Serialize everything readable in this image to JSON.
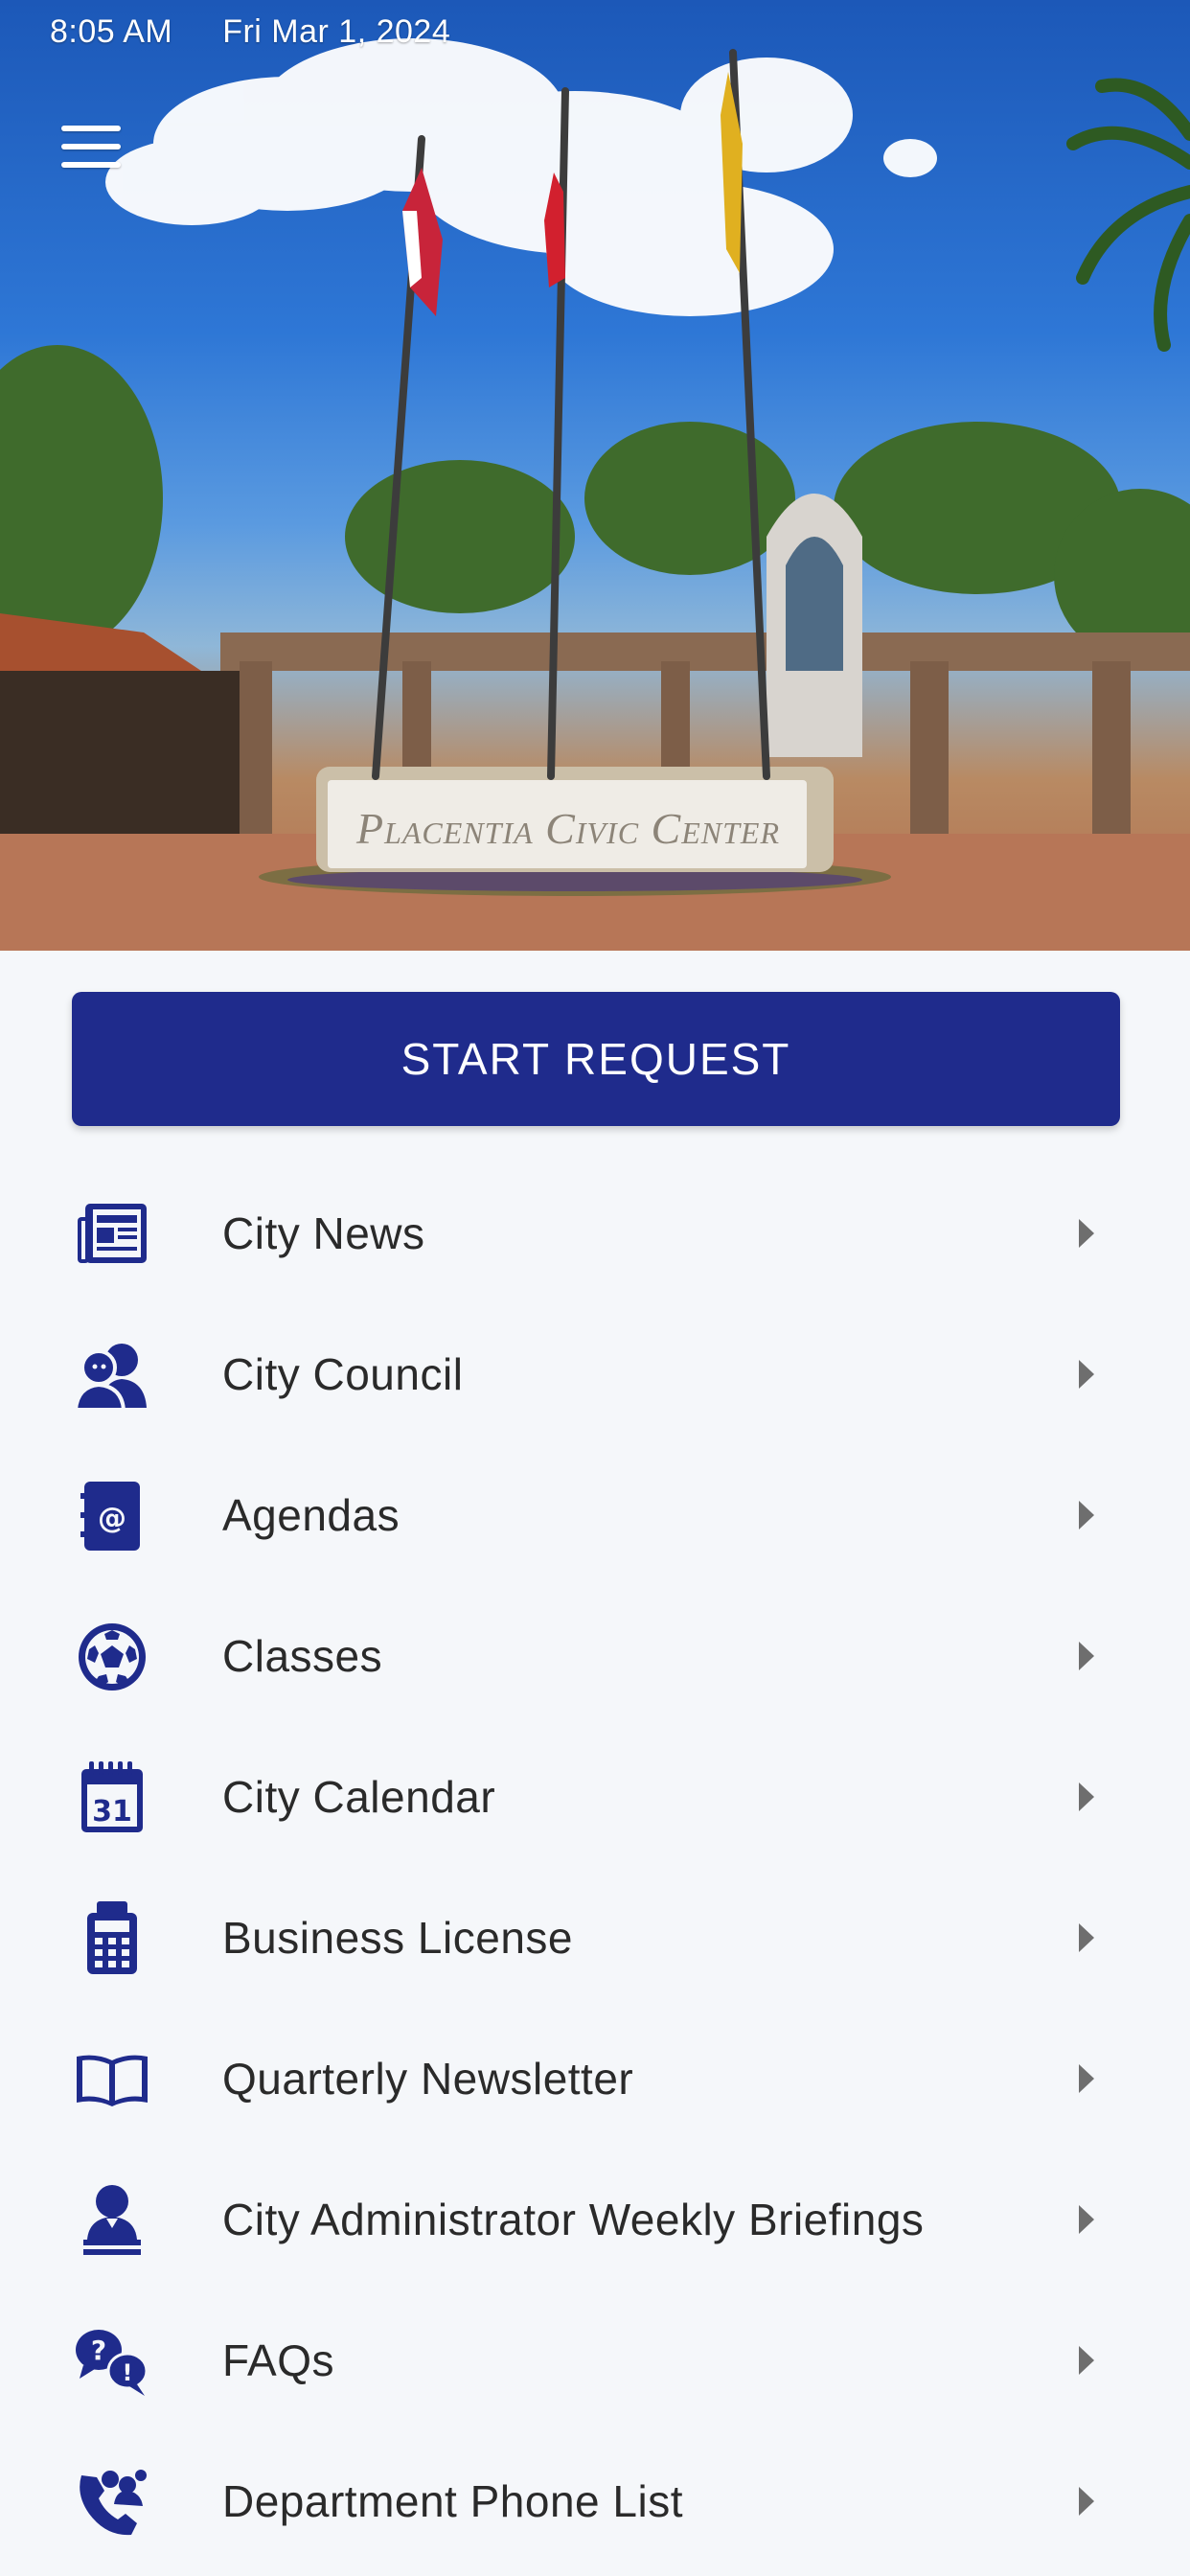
{
  "status_bar": {
    "time": "8:05 AM",
    "date": "Fri Mar 1, 2024"
  },
  "hero": {
    "sign_text": "Placentia Civic Center"
  },
  "start_request": {
    "label": "START REQUEST"
  },
  "colors": {
    "brand": "#1f2b8c",
    "background": "#f5f7fa",
    "text": "#2a2a2a"
  },
  "menu": {
    "items": [
      {
        "label": "City News",
        "icon": "newspaper-icon"
      },
      {
        "label": "City Council",
        "icon": "people-icon"
      },
      {
        "label": "Agendas",
        "icon": "address-book-icon"
      },
      {
        "label": "Classes",
        "icon": "soccer-ball-icon"
      },
      {
        "label": "City Calendar",
        "icon": "calendar-icon"
      },
      {
        "label": "Business License",
        "icon": "calculator-icon"
      },
      {
        "label": "Quarterly Newsletter",
        "icon": "open-book-icon"
      },
      {
        "label": "City Administrator Weekly Briefings",
        "icon": "presenter-icon"
      },
      {
        "label": "FAQs",
        "icon": "question-bubble-icon"
      },
      {
        "label": "Department Phone List",
        "icon": "phone-people-icon"
      }
    ]
  }
}
